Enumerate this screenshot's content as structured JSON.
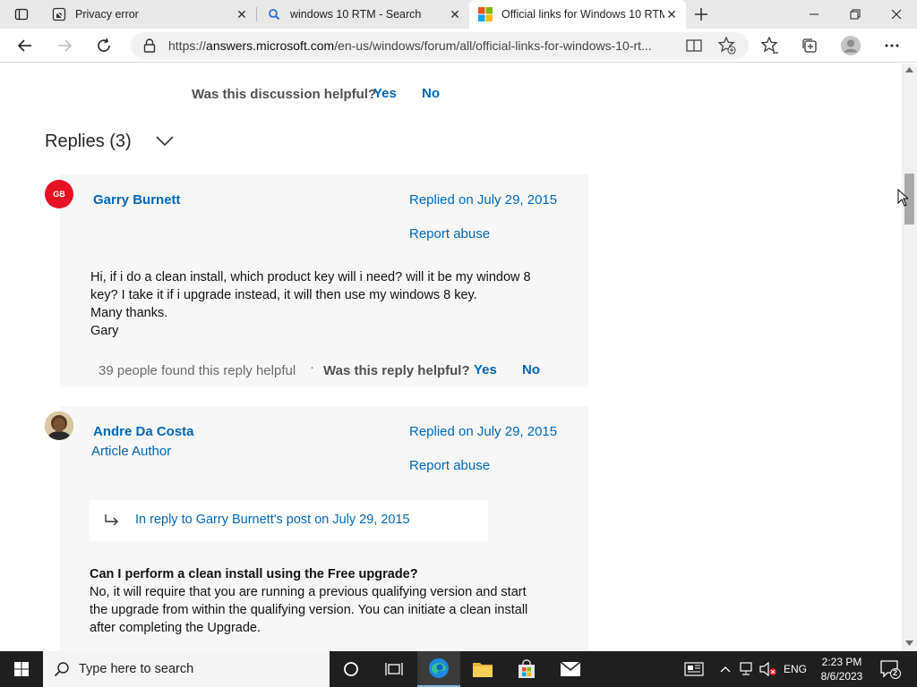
{
  "browser": {
    "tabs": [
      {
        "title": "Privacy error",
        "icon": "privacy-error-icon"
      },
      {
        "title": "windows 10 RTM - Search",
        "icon": "search-icon"
      },
      {
        "title": "Official links for Windows 10 RTM",
        "icon": "microsoft-logo-icon",
        "active": true
      }
    ],
    "url_prefix": "https://",
    "url_host": "answers.microsoft.com",
    "url_path": "/en-us/windows/forum/all/official-links-for-windows-10-rt..."
  },
  "discussion": {
    "helpful_question": "Was this discussion helpful?",
    "yes": "Yes",
    "no": "No"
  },
  "replies": {
    "heading": "Replies (3)",
    "items": [
      {
        "initials": "GB",
        "author": "Garry Burnett",
        "replied": "Replied on July 29, 2015",
        "report": "Report abuse",
        "body": [
          "Hi, if i do a clean install, which product key will i need? will it be my window 8",
          "key? I take it if i upgrade instead, it will then use my windows 8 key.",
          "Many thanks.",
          "Gary"
        ],
        "found_helpful": "39 people found this reply helpful",
        "separator": "·",
        "helpful_question": "Was this reply helpful?",
        "yes": "Yes",
        "no": "No"
      },
      {
        "author": "Andre Da Costa",
        "role": "Article Author",
        "replied": "Replied on July 29, 2015",
        "report": "Report abuse",
        "in_reply_to": "In reply to Garry Burnett's post on July 29, 2015",
        "question": "Can I perform a clean install using the Free upgrade?",
        "body": [
          "No, it will require that you are running a previous qualifying version and start",
          "the upgrade from within the qualifying version. You can initiate a clean install",
          "after completing the Upgrade."
        ]
      }
    ]
  },
  "taskbar": {
    "search_placeholder": "Type here to search",
    "language": "ENG",
    "time": "2:23 PM",
    "date": "8/6/2023",
    "notification_count": "2"
  },
  "colors": {
    "link": "#0067b8",
    "avatar_red": "#e81123",
    "card_bg": "#f7f7f7",
    "taskbar_bg": "#1f1f1f"
  }
}
